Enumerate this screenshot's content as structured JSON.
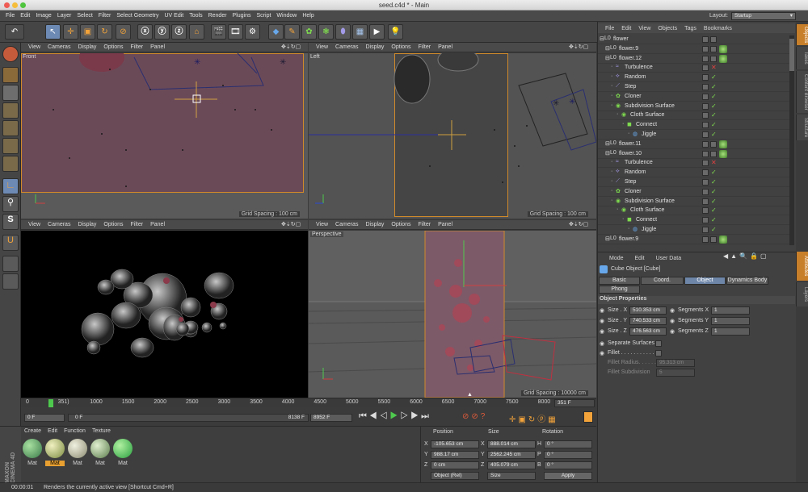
{
  "window": {
    "title": "seed.c4d * - Main"
  },
  "menu": [
    "File",
    "Edit",
    "Image",
    "Layer",
    "Select",
    "Filter",
    "Select Geometry",
    "UV Edit",
    "Tools",
    "Render",
    "Plugins",
    "Script",
    "Window",
    "Help"
  ],
  "layout": {
    "label": "Layout:",
    "value": "Startup"
  },
  "viewports": {
    "menu": [
      "View",
      "Cameras",
      "Display",
      "Options",
      "Filter",
      "Panel"
    ],
    "front": {
      "name": "Front",
      "grid": "Grid Spacing : 100 cm"
    },
    "left": {
      "name": "Left",
      "grid": "Grid Spacing : 100 cm"
    },
    "bottomleft": {
      "name": ""
    },
    "perspective": {
      "name": "Perspective",
      "grid": "Grid Spacing : 10000 cm"
    }
  },
  "objects": {
    "menu": [
      "File",
      "Edit",
      "View",
      "Objects",
      "Tags",
      "Bookmarks"
    ],
    "rows": [
      {
        "name": "flower",
        "indent": 0,
        "icon": "null",
        "status": "none",
        "tag": false
      },
      {
        "name": "flower.9",
        "indent": 1,
        "icon": "null",
        "status": "none",
        "tag": true
      },
      {
        "name": "flower.12",
        "indent": 1,
        "icon": "null",
        "status": "none",
        "tag": true
      },
      {
        "name": "Turbulence",
        "indent": 2,
        "icon": "turb",
        "status": "x",
        "tag": false
      },
      {
        "name": "Random",
        "indent": 2,
        "icon": "rand",
        "status": "check",
        "tag": false
      },
      {
        "name": "Step",
        "indent": 2,
        "icon": "step",
        "status": "check",
        "tag": false
      },
      {
        "name": "Cloner",
        "indent": 2,
        "icon": "cloner",
        "status": "check",
        "tag": false
      },
      {
        "name": "Subdivision Surface",
        "indent": 2,
        "icon": "sds",
        "status": "check",
        "tag": false
      },
      {
        "name": "Cloth Surface",
        "indent": 3,
        "icon": "cloth",
        "status": "check",
        "tag": false
      },
      {
        "name": "Connect",
        "indent": 4,
        "icon": "connect",
        "status": "check",
        "tag": false
      },
      {
        "name": "Jiggle",
        "indent": 5,
        "icon": "jiggle",
        "status": "check",
        "tag": false
      },
      {
        "name": "flower.11",
        "indent": 1,
        "icon": "null",
        "status": "none",
        "tag": true
      },
      {
        "name": "flower.10",
        "indent": 1,
        "icon": "null",
        "status": "none",
        "tag": true
      },
      {
        "name": "Turbulence",
        "indent": 2,
        "icon": "turb",
        "status": "x",
        "tag": false
      },
      {
        "name": "Random",
        "indent": 2,
        "icon": "rand",
        "status": "check",
        "tag": false
      },
      {
        "name": "Step",
        "indent": 2,
        "icon": "step",
        "status": "check",
        "tag": false
      },
      {
        "name": "Cloner",
        "indent": 2,
        "icon": "cloner",
        "status": "check",
        "tag": false
      },
      {
        "name": "Subdivision Surface",
        "indent": 2,
        "icon": "sds",
        "status": "check",
        "tag": false
      },
      {
        "name": "Cloth Surface",
        "indent": 3,
        "icon": "cloth",
        "status": "check",
        "tag": false
      },
      {
        "name": "Connect",
        "indent": 4,
        "icon": "connect",
        "status": "check",
        "tag": false
      },
      {
        "name": "Jiggle",
        "indent": 5,
        "icon": "jiggle",
        "status": "check",
        "tag": false
      },
      {
        "name": "flower.9",
        "indent": 1,
        "icon": "null",
        "status": "none",
        "tag": true
      }
    ]
  },
  "side_tabs_top": [
    "Objects",
    "Takes",
    "Content Browser",
    "Structure"
  ],
  "side_tabs_bottom": [
    "Attributes",
    "Layers"
  ],
  "attributes": {
    "menu": [
      "Mode",
      "Edit",
      "User Data"
    ],
    "header": "Cube Object [Cube]",
    "tabs": [
      "Basic",
      "Coord.",
      "Object",
      "Dynamics Body",
      "Phong"
    ],
    "section": "Object Properties",
    "size_x_label": "Size . X",
    "size_x": "510.353 cm",
    "size_y_label": "Size . Y",
    "size_y": "740.533 cm",
    "size_z_label": "Size . Z",
    "size_z": "476.563 cm",
    "seg_x_label": "Segments X",
    "seg_x": "1",
    "seg_y_label": "Segments Y",
    "seg_y": "1",
    "seg_z_label": "Segments Z",
    "seg_z": "1",
    "separate": "Separate Surfaces",
    "fillet": "Fillet . . . . . . . . . . .",
    "fillet_radius_label": "Fillet Radius. . . . . .",
    "fillet_radius": "95.313 cm",
    "fillet_sub_label": "Fillet Subdivision",
    "fillet_sub": "5"
  },
  "timeline": {
    "ticks": [
      "0",
      "351)",
      "1000",
      "1500",
      "2000",
      "2500",
      "3000",
      "3500",
      "4000",
      "4500",
      "5000",
      "5500",
      "6000",
      "6500",
      "7000",
      "7500",
      "8000",
      "8500"
    ],
    "end_field": "351 F",
    "start": "0 F",
    "range_start": "0 F",
    "range_end": "8138 F",
    "end": "8952 F"
  },
  "materials": {
    "menu": [
      "Create",
      "Edit",
      "Function",
      "Texture"
    ],
    "items": [
      "Mat",
      "Mat",
      "Mat",
      "Mat",
      "Mat"
    ],
    "brand": "MAXON CINEMA 4D"
  },
  "coords": {
    "headers": [
      "Position",
      "Size",
      "Rotation"
    ],
    "px_label": "X",
    "px": "-105.653 cm",
    "sx_label": "X",
    "sx": "888.014 cm",
    "rh_label": "H",
    "rh": "0 °",
    "py_label": "Y",
    "py": "988.17 cm",
    "sy_label": "Y",
    "sy": "2562.245 cm",
    "rp_label": "P",
    "rp": "0 °",
    "pz_label": "Z",
    "pz": "0 cm",
    "sz_label": "Z",
    "sz": "405.079 cm",
    "rb_label": "B",
    "rb": "0 °",
    "mode": "Object (Rel)",
    "size_mode": "Size",
    "apply": "Apply"
  },
  "status": {
    "time": "00:00:01",
    "text": "Renders the currently active view [Shortcut Cmd+R]"
  }
}
